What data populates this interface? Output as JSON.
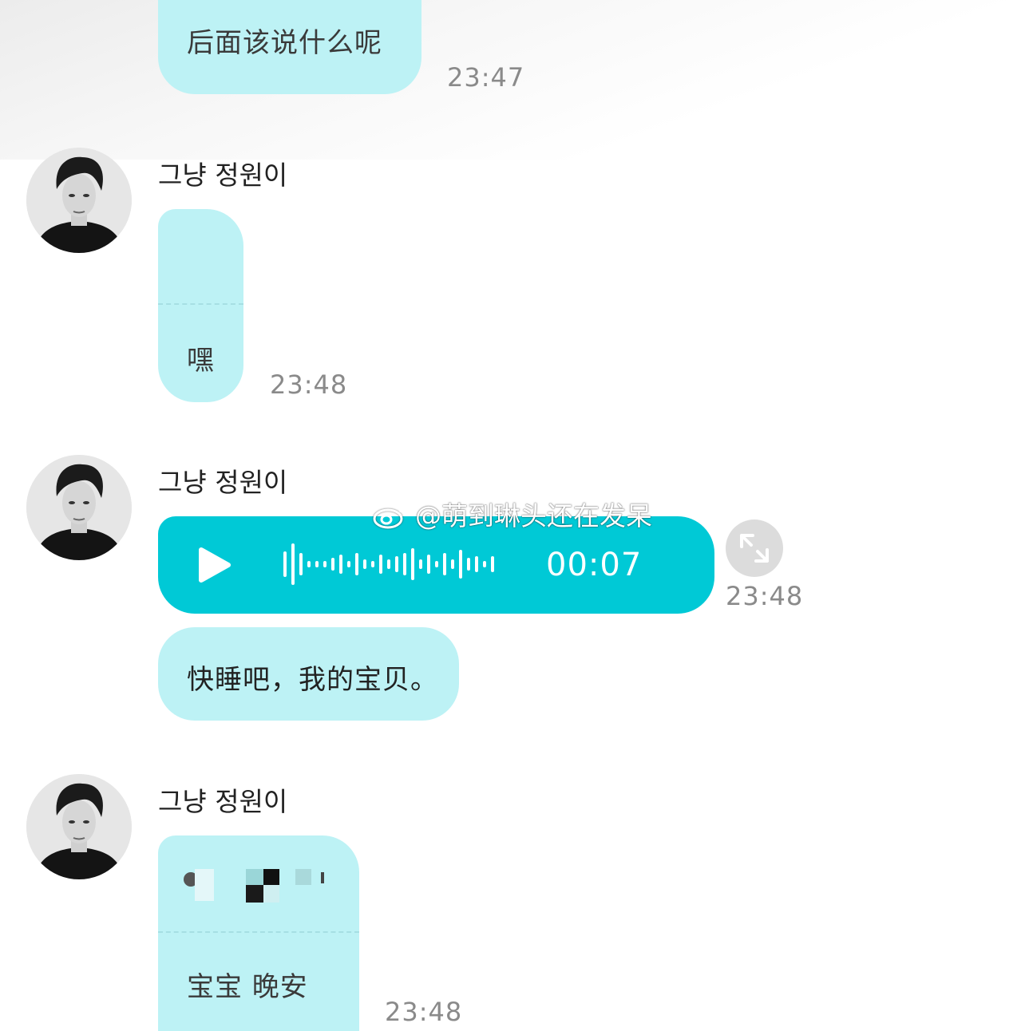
{
  "messages": {
    "m1": {
      "text": "后面该说什么呢",
      "time": "23:47"
    },
    "m2": {
      "sender": "그냥 정원이",
      "text": "嘿",
      "time": "23:48"
    },
    "m3": {
      "sender": "그냥 정원이",
      "voice_duration": "00:07",
      "time": "23:48"
    },
    "m4": {
      "text": "快睡吧，我的宝贝。"
    },
    "m5": {
      "sender": "그냥 정원이",
      "text": "宝宝 晚安",
      "time": "23:48"
    }
  },
  "watermark": {
    "text": "@萌到琳头还在发呆",
    "icon": "weibo-icon"
  },
  "colors": {
    "bubble": "#bdf2f5",
    "voice_bubble": "#00c9d6",
    "time_text": "#8a8a8a"
  }
}
